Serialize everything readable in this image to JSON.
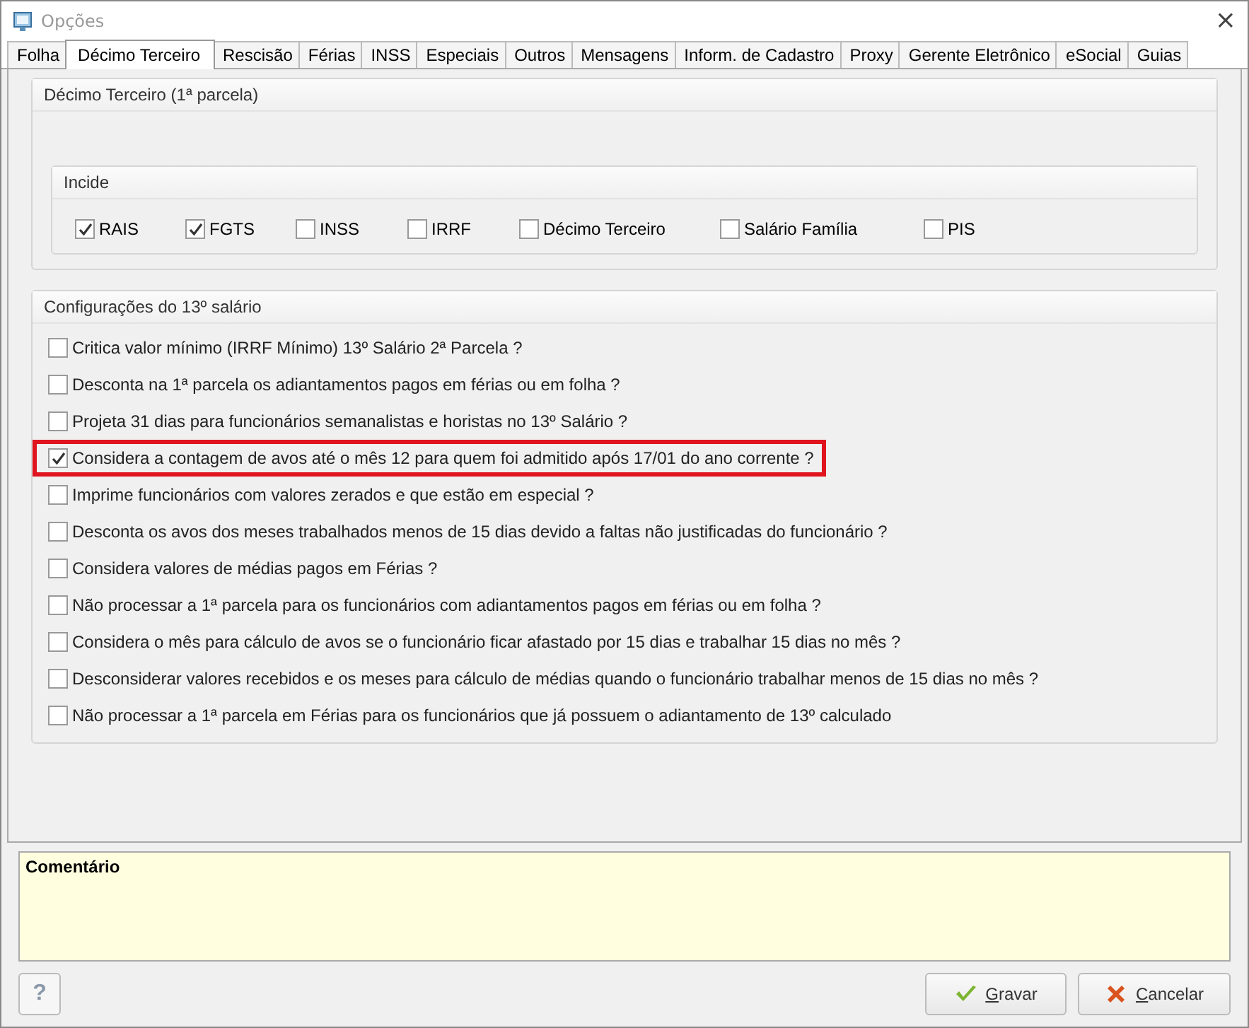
{
  "window": {
    "title": "Opções",
    "close": "×"
  },
  "tabs": [
    {
      "label": "Folha",
      "selected": false
    },
    {
      "label": "Décimo Terceiro",
      "selected": true
    },
    {
      "label": "Rescisão",
      "selected": false
    },
    {
      "label": "Férias",
      "selected": false
    },
    {
      "label": "INSS",
      "selected": false
    },
    {
      "label": "Especiais",
      "selected": false
    },
    {
      "label": "Outros",
      "selected": false
    },
    {
      "label": "Mensagens",
      "selected": false
    },
    {
      "label": "Inform. de Cadastro",
      "selected": false
    },
    {
      "label": "Proxy",
      "selected": false
    },
    {
      "label": "Gerente Eletrônico",
      "selected": false
    },
    {
      "label": "eSocial",
      "selected": false
    },
    {
      "label": "Guias",
      "selected": false
    }
  ],
  "first_installment": {
    "title": "Décimo Terceiro (1ª parcela)",
    "incide": {
      "title": "Incide",
      "items": [
        {
          "label": "RAIS",
          "checked": true
        },
        {
          "label": "FGTS",
          "checked": true
        },
        {
          "label": "INSS",
          "checked": false
        },
        {
          "label": "IRRF",
          "checked": false
        },
        {
          "label": "Décimo Terceiro",
          "checked": false
        },
        {
          "label": "Salário Família",
          "checked": false
        },
        {
          "label": "PIS",
          "checked": false
        }
      ]
    }
  },
  "settings": {
    "title": "Configurações do 13º salário",
    "options": [
      {
        "label": "Critica valor mínimo (IRRF Mínimo) 13º Salário 2ª Parcela ?",
        "checked": false,
        "highlighted": false
      },
      {
        "label": "Desconta na 1ª parcela os adiantamentos pagos em férias ou em folha ?",
        "checked": false,
        "highlighted": false
      },
      {
        "label": "Projeta 31 dias para funcionários semanalistas e horistas no 13º Salário ?",
        "checked": false,
        "highlighted": false
      },
      {
        "label": "Considera a contagem de avos até o mês 12 para quem foi admitido após 17/01 do ano corrente ?",
        "checked": true,
        "highlighted": true
      },
      {
        "label": "Imprime funcionários com valores zerados e que estão em especial ?",
        "checked": false,
        "highlighted": false
      },
      {
        "label": "Desconta os avos dos meses trabalhados menos de 15 dias devido a faltas não justificadas do funcionário ?",
        "checked": false,
        "highlighted": false
      },
      {
        "label": "Considera valores de médias pagos em Férias ?",
        "checked": false,
        "highlighted": false
      },
      {
        "label": "Não processar a 1ª parcela para os funcionários com adiantamentos pagos em férias ou em folha ?",
        "checked": false,
        "highlighted": false
      },
      {
        "label": "Considera o mês para cálculo de avos se o funcionário ficar afastado por 15 dias e trabalhar 15 dias no mês ?",
        "checked": false,
        "highlighted": false
      },
      {
        "label": "Desconsiderar valores recebidos e os meses para cálculo de médias quando o funcionário trabalhar menos de 15 dias no mês ?",
        "checked": false,
        "highlighted": false
      },
      {
        "label": "Não processar a 1ª parcela em Férias para os funcionários que já possuem o adiantamento de 13º calculado",
        "checked": false,
        "highlighted": false
      }
    ]
  },
  "comment": {
    "label": "Comentário"
  },
  "help_button": "?",
  "buttons": [
    {
      "label": "Gravar",
      "kind": "save"
    },
    {
      "label": "Cancelar",
      "kind": "cancel"
    }
  ]
}
